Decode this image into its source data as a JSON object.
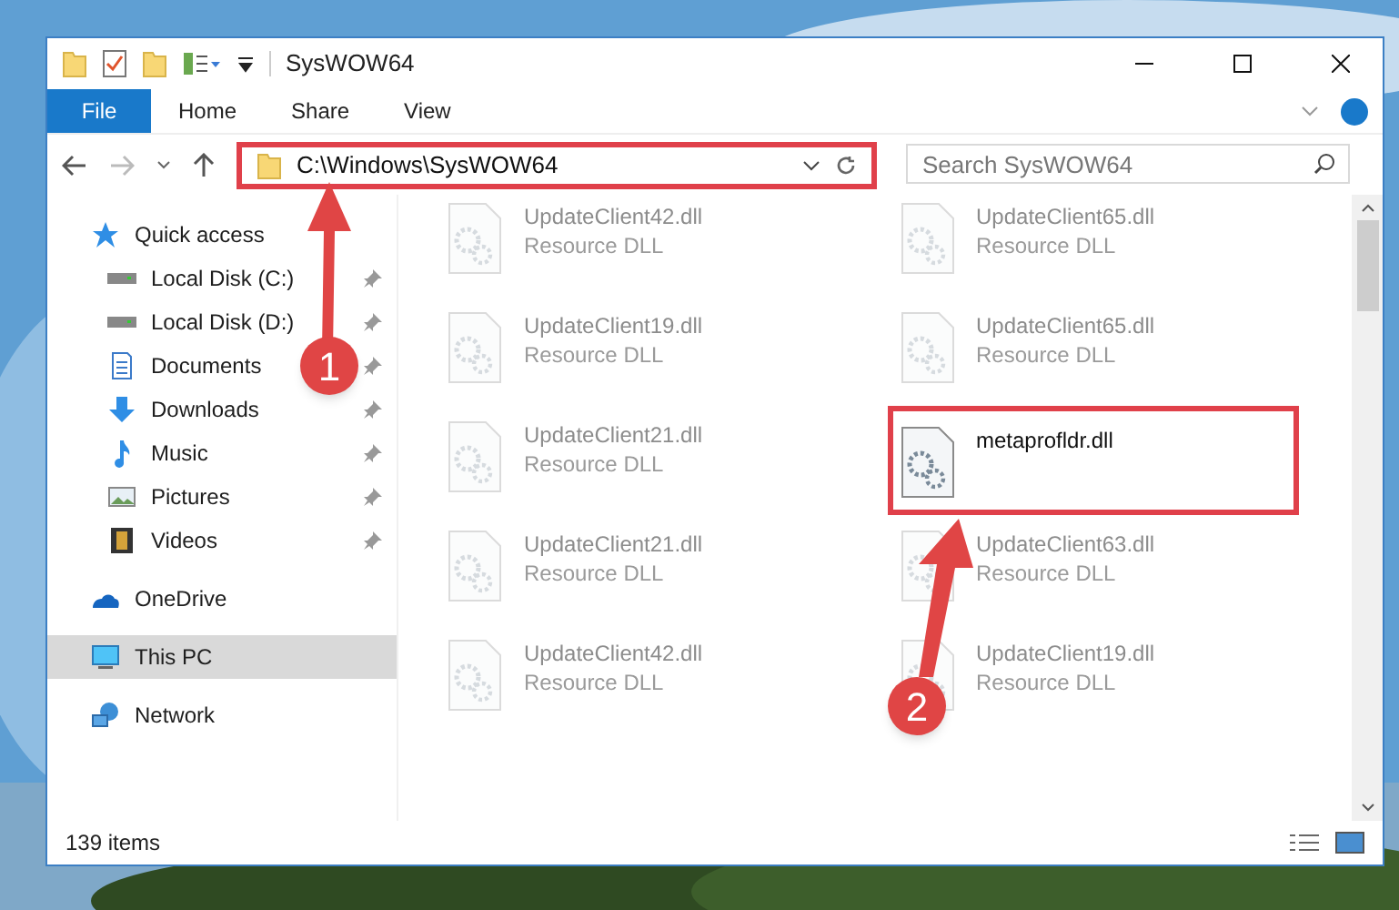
{
  "window": {
    "title": "SysWOW64"
  },
  "ribbon_tabs": [
    {
      "label": "File",
      "kind": "file"
    },
    {
      "label": "Home",
      "kind": "tab"
    },
    {
      "label": "Share",
      "kind": "tab"
    },
    {
      "label": "View",
      "kind": "tab"
    }
  ],
  "address_bar": {
    "value": "C:\\Windows\\SysWOW64",
    "highlighted": true
  },
  "search": {
    "placeholder": "Search SysWOW64"
  },
  "sidebar": {
    "items": [
      {
        "label": "Quick access",
        "selected": false,
        "children": [
          {
            "label": "Local Disk (C:)",
            "selected": false,
            "pinned": true
          },
          {
            "label": "Local Disk (D:)",
            "selected": false,
            "pinned": true
          },
          {
            "label": "Documents",
            "selected": false,
            "pinned": true
          },
          {
            "label": "Downloads",
            "selected": false,
            "pinned": true
          },
          {
            "label": "Music",
            "selected": false,
            "pinned": true
          },
          {
            "label": "Pictures",
            "selected": false,
            "pinned": true
          },
          {
            "label": "Videos",
            "selected": false,
            "pinned": true
          }
        ]
      },
      {
        "label": "OneDrive",
        "selected": false
      },
      {
        "label": "This PC",
        "selected": true
      },
      {
        "label": "Network",
        "selected": false
      }
    ]
  },
  "files": [
    {
      "name": "UpdateClient42.dll",
      "type": "Resource DLL",
      "blurred": true,
      "highlighted": false
    },
    {
      "name": "UpdateClient65.dll",
      "type": "Resource DLL",
      "blurred": true,
      "highlighted": false
    },
    {
      "name": "UpdateClient19.dll",
      "type": "Resource DLL",
      "blurred": true,
      "highlighted": false
    },
    {
      "name": "UpdateClient65.dll",
      "type": "Resource DLL",
      "blurred": true,
      "highlighted": false
    },
    {
      "name": "UpdateClient21.dll",
      "type": "Resource DLL",
      "blurred": true,
      "highlighted": false
    },
    {
      "name": "metaprofldr.dll",
      "blurred": false,
      "highlighted": true
    },
    {
      "name": "UpdateClient21.dll",
      "type": "Resource DLL",
      "blurred": true,
      "highlighted": false
    },
    {
      "name": "UpdateClient63.dll",
      "type": "Resource DLL",
      "blurred": true,
      "highlighted": false
    },
    {
      "name": "UpdateClient42.dll",
      "type": "Resource DLL",
      "blurred": true,
      "highlighted": false
    },
    {
      "name": "UpdateClient19.dll",
      "type": "Resource DLL",
      "blurred": true,
      "highlighted": false
    }
  ],
  "status_bar": {
    "item_count": "139 items"
  },
  "annotations": [
    {
      "label": "1"
    },
    {
      "label": "2"
    }
  ]
}
